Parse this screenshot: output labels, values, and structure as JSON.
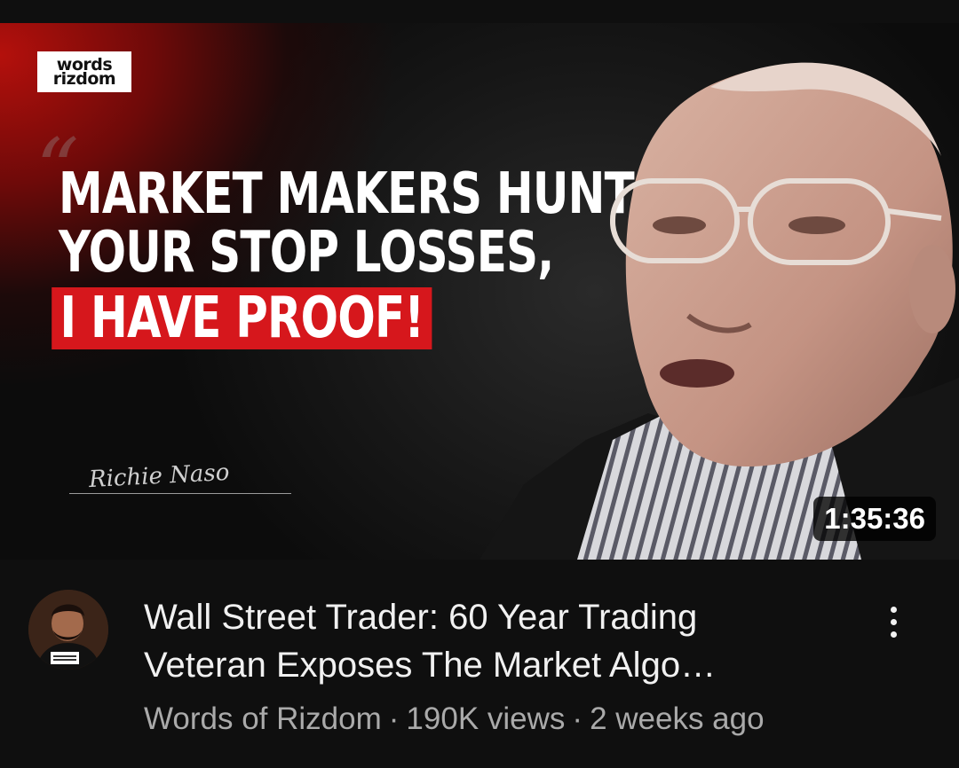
{
  "thumbnail": {
    "logo_line1": "words",
    "logo_line2": "rizdom",
    "headline_line1": "MARKET MAKERS HUNT",
    "headline_line2": "YOUR STOP LOSSES,",
    "headline_line3": "I HAVE PROOF!",
    "signature": "Richie Naso",
    "duration": "1:35:36",
    "accent_color": "#d6171c"
  },
  "video": {
    "title_line1": "Wall Street Trader: 60 Year Trading",
    "title_line2": "Veteran Exposes The Market Algo…",
    "channel": "Words of Rizdom",
    "views": "190K views",
    "age": "2 weeks ago",
    "separator": "·"
  },
  "icons": {
    "menu": "more-vert-icon",
    "channel_avatar": "avatar"
  }
}
